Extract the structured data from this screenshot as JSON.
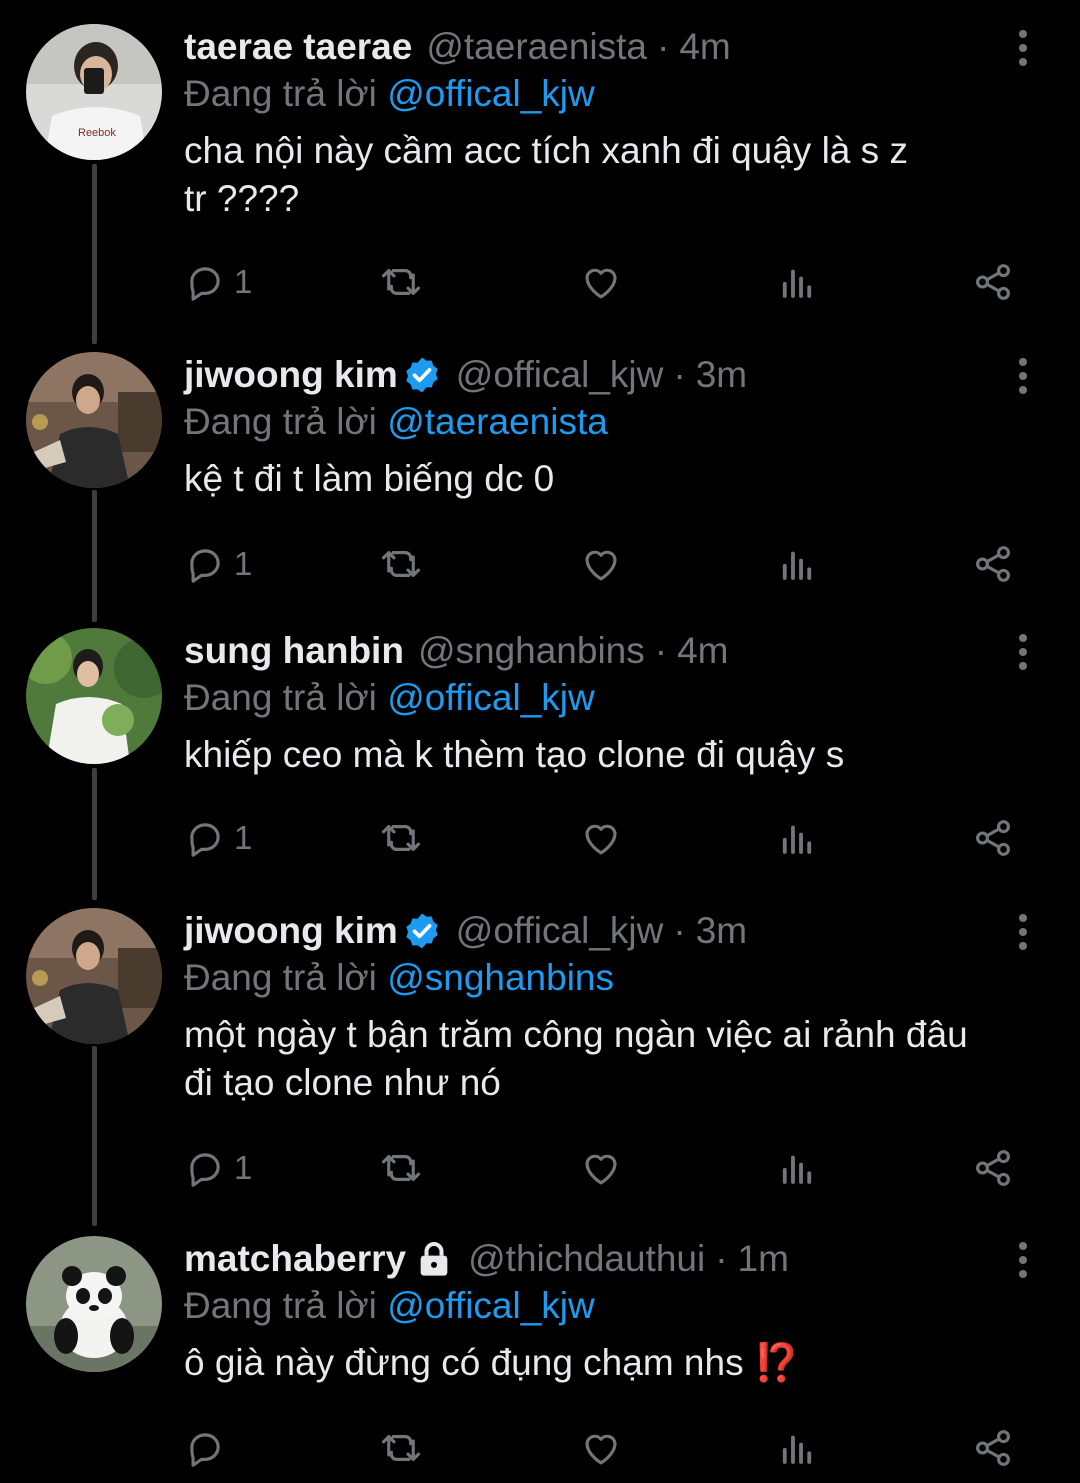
{
  "replying_prefix": "Đang trả lời",
  "colors": {
    "background": "#000000",
    "text": "#e7e9ea",
    "muted": "#71767b",
    "accent": "#1d9bf0",
    "verified": "#1d9bf0"
  },
  "tweets": [
    {
      "name": "taerae taerae",
      "handle": "@taeraenista",
      "sep": "·",
      "time": "4m",
      "replying_to": "@offical_kjw",
      "text": "cha nội này cầm acc tích xanh đi quậy là s z\ntr ????",
      "reply_count": "1",
      "verified": false,
      "locked": false,
      "avatar_icon": "person-photo-avatar"
    },
    {
      "name": "jiwoong kim",
      "handle": "@offical_kjw",
      "sep": "·",
      "time": "3m",
      "replying_to": "@taeraenista",
      "text": "kệ t đi t làm biếng dc 0",
      "reply_count": "1",
      "verified": true,
      "locked": false,
      "avatar_icon": "person-photo-avatar"
    },
    {
      "name": "sung hanbin",
      "handle": "@snghanbins",
      "sep": "·",
      "time": "4m",
      "replying_to": "@offical_kjw",
      "text": "khiếp ceo mà k thèm tạo clone đi quậy s",
      "reply_count": "1",
      "verified": false,
      "locked": false,
      "avatar_icon": "person-photo-avatar"
    },
    {
      "name": "jiwoong kim",
      "handle": "@offical_kjw",
      "sep": "·",
      "time": "3m",
      "replying_to": "@snghanbins",
      "text": "một ngày t bận trăm công ngàn việc ai rảnh đâu\nđi tạo clone như nó",
      "reply_count": "1",
      "verified": true,
      "locked": false,
      "avatar_icon": "person-photo-avatar"
    },
    {
      "name": "matchaberry",
      "handle": "@thichdauthui",
      "sep": "·",
      "time": "1m",
      "replying_to": "@offical_kjw",
      "text": "ô già này đừng có đụng chạm nhs ⁉️",
      "reply_count": "",
      "verified": false,
      "locked": true,
      "avatar_icon": "panda-photo-avatar"
    }
  ]
}
